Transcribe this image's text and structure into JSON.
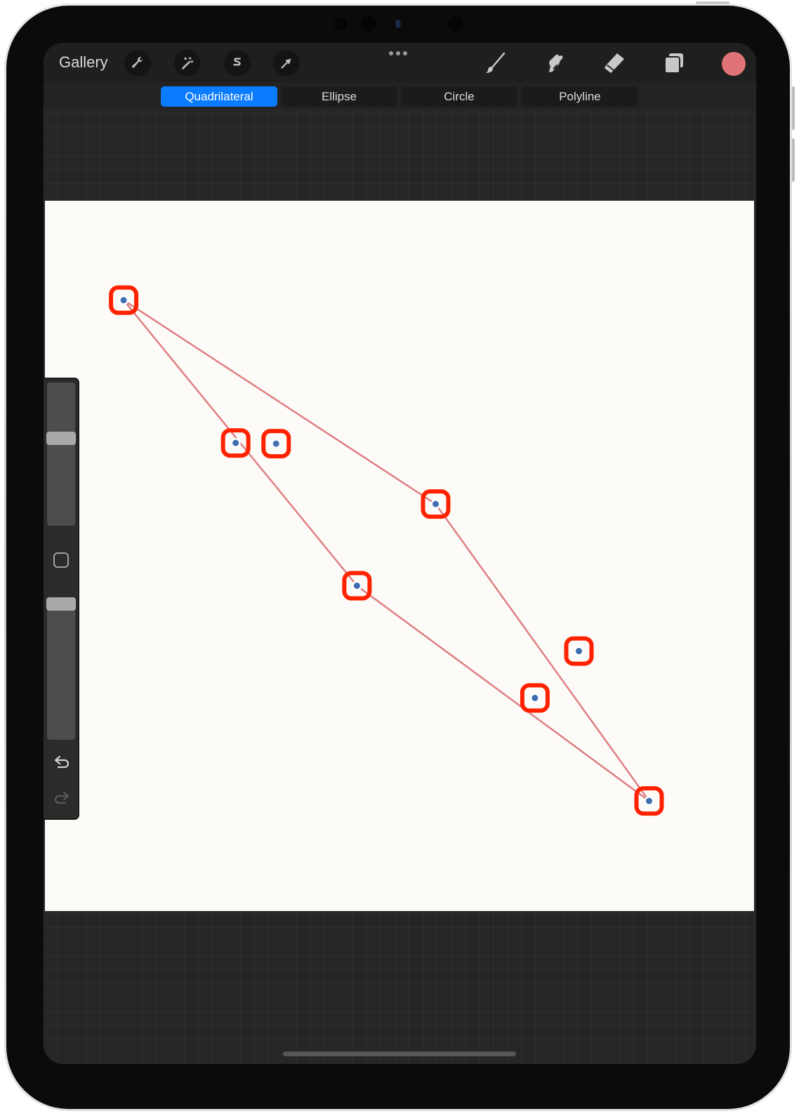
{
  "app": {
    "toolbar": {
      "gallery_label": "Gallery",
      "left_tools": [
        {
          "name": "actions",
          "icon": "wrench-icon"
        },
        {
          "name": "adjustments",
          "icon": "magic-wand-icon"
        },
        {
          "name": "selection",
          "icon": "selection-s-icon"
        },
        {
          "name": "transform",
          "icon": "arrow-cursor-icon"
        }
      ],
      "more_icon": "more-dots-icon",
      "right_tools": [
        {
          "name": "brush",
          "icon": "brush-icon"
        },
        {
          "name": "smudge",
          "icon": "smudge-finger-icon"
        },
        {
          "name": "eraser",
          "icon": "eraser-icon"
        },
        {
          "name": "layers",
          "icon": "layers-icon"
        }
      ],
      "current_color": "#e07378"
    },
    "shape_bar": {
      "tabs": [
        {
          "label": "Quadrilateral",
          "active": true
        },
        {
          "label": "Ellipse",
          "active": false
        },
        {
          "label": "Circle",
          "active": false
        },
        {
          "label": "Polyline",
          "active": false
        }
      ],
      "active_color": "#0a7cff"
    },
    "canvas": {
      "background": "#fcfbf8",
      "shape": {
        "type": "quadrilateral",
        "stroke_color": "#de7b80",
        "node_color": "#3f6fb0",
        "highlight_color": "#ff2200",
        "vertices_normalized": [
          [
            0.111,
            0.14
          ],
          [
            0.852,
            0.845
          ],
          [
            0.551,
            0.427
          ],
          [
            0.44,
            0.542
          ],
          [
            0.269,
            0.341
          ],
          [
            0.753,
            0.634
          ],
          [
            0.326,
            0.342
          ],
          [
            0.691,
            0.7
          ]
        ]
      }
    },
    "sidebar": {
      "brush_size_fraction": 0.62,
      "opacity_fraction": 1.0,
      "modify_icon": "square-modify-icon",
      "undo_icon": "undo-icon",
      "redo_icon": "redo-icon"
    }
  }
}
